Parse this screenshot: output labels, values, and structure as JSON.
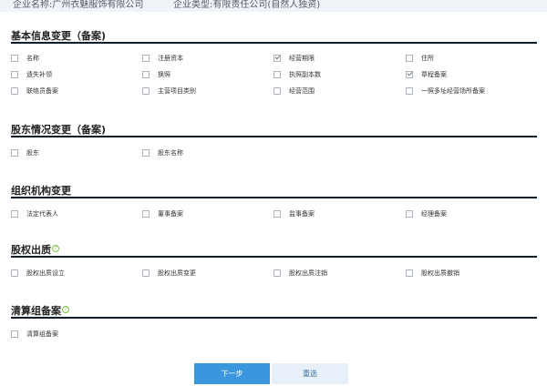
{
  "header": {
    "company_name": "企业名称:广州衣魅服饰有限公司",
    "company_type": "企业类型:有限责任公司(自然人独资)"
  },
  "sections": {
    "basic": {
      "title": "基本信息变更（备案)",
      "items": [
        {
          "label": "名称",
          "checked": false
        },
        {
          "label": "注册资本",
          "checked": false
        },
        {
          "label": "经营期限",
          "checked": true
        },
        {
          "label": "住所",
          "checked": false
        },
        {
          "label": "遗失补领",
          "checked": false
        },
        {
          "label": "换照",
          "checked": false
        },
        {
          "label": "执照副本数",
          "checked": false
        },
        {
          "label": "章程备案",
          "checked": true
        },
        {
          "label": "联络员备案",
          "checked": false
        },
        {
          "label": "主营项目类别",
          "checked": false
        },
        {
          "label": "经营范围",
          "checked": false
        },
        {
          "label": "一照多址经营场所备案",
          "checked": false
        }
      ]
    },
    "shareholder": {
      "title": "股东情况变更（备案)",
      "items": [
        {
          "label": "股东",
          "checked": false
        },
        {
          "label": "股东名称",
          "checked": false
        }
      ]
    },
    "org": {
      "title": "组织机构变更",
      "items": [
        {
          "label": "法定代表人",
          "checked": false
        },
        {
          "label": "董事备案",
          "checked": false
        },
        {
          "label": "监事备案",
          "checked": false
        },
        {
          "label": "经理备案",
          "checked": false
        }
      ]
    },
    "pledge": {
      "title": "股权出质",
      "items": [
        {
          "label": "股权出质设立",
          "checked": false
        },
        {
          "label": "股权出质变更",
          "checked": false
        },
        {
          "label": "股权出质注销",
          "checked": false
        },
        {
          "label": "股权出质撤销",
          "checked": false
        }
      ]
    },
    "liquidation": {
      "title": "清算组备案",
      "items": [
        {
          "label": "清算组备案",
          "checked": false
        }
      ]
    }
  },
  "help_icon_glyph": "?",
  "buttons": {
    "next": "下一步",
    "reset": "重选"
  },
  "colors": {
    "primary": "#3a97de",
    "secondary": "#e7f0f8",
    "rule": "#0d1b2a",
    "help": "#7ac141"
  }
}
